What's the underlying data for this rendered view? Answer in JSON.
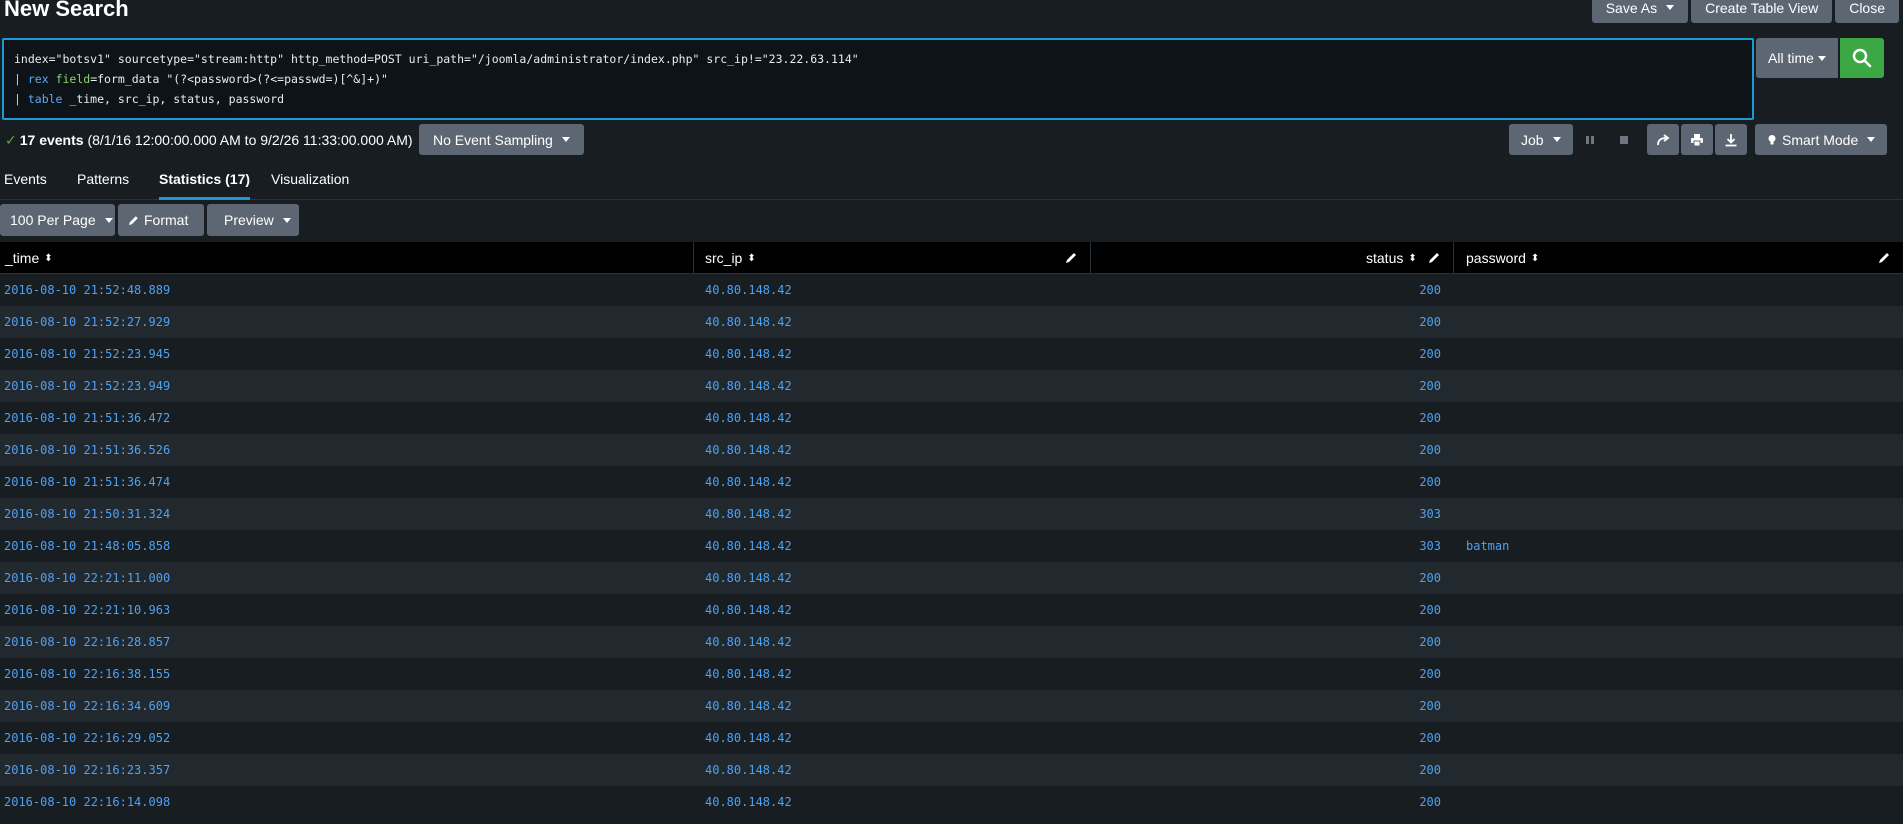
{
  "page": {
    "title": "New Search"
  },
  "top_actions": {
    "save_as": "Save As",
    "create_table_view": "Create Table View",
    "close": "Close"
  },
  "search": {
    "lines": [
      {
        "text": "index=\"botsv1\" sourcetype=\"stream:http\" http_method=POST uri_path=\"/joomla/administrator/index.php\" src_ip!=\"23.22.63.114\""
      },
      {
        "pipe": "| ",
        "cmd": "rex",
        "space1": " ",
        "arg": "field",
        "rest": "=form_data \"(?<password>(?<=passwd=)[^&]+)\""
      },
      {
        "pipe": "| ",
        "cmd": "table",
        "rest": " _time, src_ip, status, password"
      }
    ],
    "time_range": "All time",
    "search_icon": "search-icon"
  },
  "status": {
    "count_label": "17 events",
    "range_label": "(8/1/16 12:00:00.000 AM to 9/2/26 11:33:00.000 AM)",
    "sampling": "No Event Sampling",
    "job": "Job",
    "mode": "Smart Mode"
  },
  "tabs": [
    {
      "label": "Events",
      "active": false
    },
    {
      "label": "Patterns",
      "active": false
    },
    {
      "label": "Statistics (17)",
      "active": true
    },
    {
      "label": "Visualization",
      "active": false
    }
  ],
  "table_controls": {
    "per_page": "100 Per Page",
    "format": "Format",
    "preview": "Preview"
  },
  "table": {
    "columns": [
      "_time",
      "src_ip",
      "status",
      "password"
    ],
    "rows": [
      {
        "time": "2016-08-10 21:52:48.889",
        "src_ip": "40.80.148.42",
        "status": "200",
        "password": ""
      },
      {
        "time": "2016-08-10 21:52:27.929",
        "src_ip": "40.80.148.42",
        "status": "200",
        "password": ""
      },
      {
        "time": "2016-08-10 21:52:23.945",
        "src_ip": "40.80.148.42",
        "status": "200",
        "password": ""
      },
      {
        "time": "2016-08-10 21:52:23.949",
        "src_ip": "40.80.148.42",
        "status": "200",
        "password": ""
      },
      {
        "time": "2016-08-10 21:51:36.472",
        "src_ip": "40.80.148.42",
        "status": "200",
        "password": ""
      },
      {
        "time": "2016-08-10 21:51:36.526",
        "src_ip": "40.80.148.42",
        "status": "200",
        "password": ""
      },
      {
        "time": "2016-08-10 21:51:36.474",
        "src_ip": "40.80.148.42",
        "status": "200",
        "password": ""
      },
      {
        "time": "2016-08-10 21:50:31.324",
        "src_ip": "40.80.148.42",
        "status": "303",
        "password": ""
      },
      {
        "time": "2016-08-10 21:48:05.858",
        "src_ip": "40.80.148.42",
        "status": "303",
        "password": "batman"
      },
      {
        "time": "2016-08-10 22:21:11.000",
        "src_ip": "40.80.148.42",
        "status": "200",
        "password": ""
      },
      {
        "time": "2016-08-10 22:21:10.963",
        "src_ip": "40.80.148.42",
        "status": "200",
        "password": ""
      },
      {
        "time": "2016-08-10 22:16:28.857",
        "src_ip": "40.80.148.42",
        "status": "200",
        "password": ""
      },
      {
        "time": "2016-08-10 22:16:38.155",
        "src_ip": "40.80.148.42",
        "status": "200",
        "password": ""
      },
      {
        "time": "2016-08-10 22:16:34.609",
        "src_ip": "40.80.148.42",
        "status": "200",
        "password": ""
      },
      {
        "time": "2016-08-10 22:16:29.052",
        "src_ip": "40.80.148.42",
        "status": "200",
        "password": ""
      },
      {
        "time": "2016-08-10 22:16:23.357",
        "src_ip": "40.80.148.42",
        "status": "200",
        "password": ""
      },
      {
        "time": "2016-08-10 22:16:14.098",
        "src_ip": "40.80.148.42",
        "status": "200",
        "password": ""
      }
    ]
  },
  "colors": {
    "accent": "#1a9bd7",
    "link": "#4ea1f3",
    "search_green": "#3ca844",
    "button_gray": "#5c6773"
  }
}
